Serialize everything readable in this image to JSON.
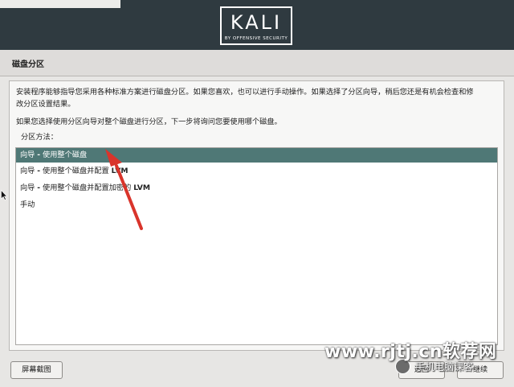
{
  "header": {
    "logo_text": "KALI",
    "logo_subtitle": "BY OFFENSIVE SECURITY"
  },
  "page": {
    "title": "磁盘分区"
  },
  "content": {
    "paragraph1_line1": "安装程序能够指导您采用各种标准方案进行磁盘分区。如果您喜欢，也可以进行手动操作。如果选择了分区向导，稍后您还是有机会检查和修",
    "paragraph1_line2": "改分区设置结果。",
    "paragraph2": "如果您选择使用分区向导对整个磁盘进行分区，下一步将询问您要使用哪个磁盘。",
    "prompt": "分区方法："
  },
  "options": [
    {
      "prefix": "向导 ",
      "dash": "-",
      "text": " 使用整个磁盘",
      "suffix": ""
    },
    {
      "prefix": "向导 ",
      "dash": "-",
      "text": " 使用整个磁盘并配置 ",
      "suffix": "LVM"
    },
    {
      "prefix": "向导 ",
      "dash": "-",
      "text": " 使用整个磁盘并配置加密的 ",
      "suffix": "LVM"
    },
    {
      "prefix": "手动",
      "dash": "",
      "text": "",
      "suffix": ""
    }
  ],
  "selected_index": 0,
  "buttons": {
    "screenshot": "屏幕截图",
    "back": "返回",
    "continue": "继续"
  },
  "watermark": {
    "line1": "www.rjtj.cn软荐网",
    "line2": "手机电脑课客"
  },
  "colors": {
    "header_bg": "#2f3a40",
    "selected_bg": "#4f7876",
    "arrow": "#d9342b"
  }
}
